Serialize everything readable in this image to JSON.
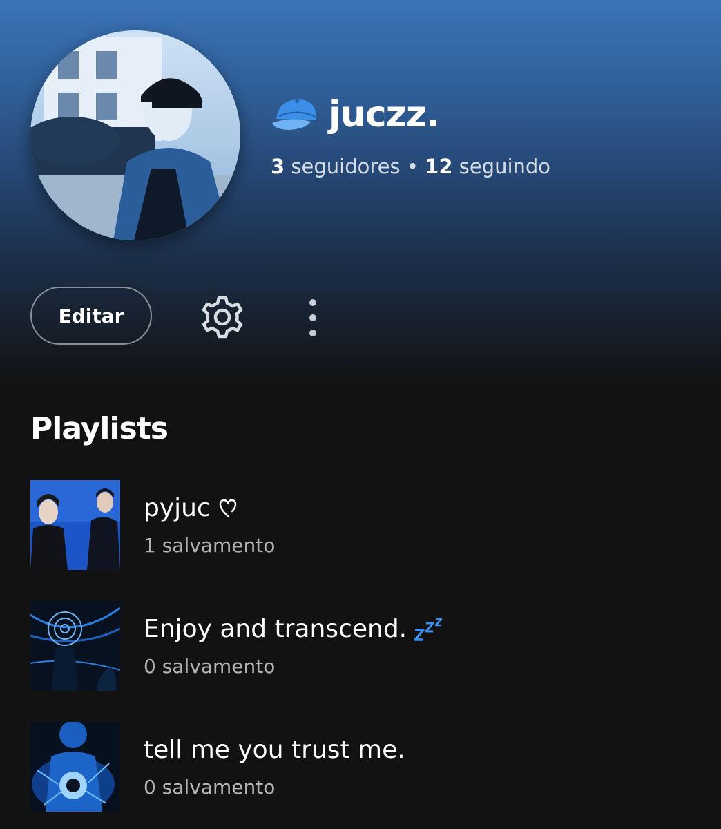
{
  "theme": {
    "accent": "#3b74b8",
    "background": "#121212",
    "secondary_text": "#b3b3b3"
  },
  "profile": {
    "emoji_icon": "blue-cap-icon",
    "username": "juczz.",
    "followers_count": "3",
    "followers_label": "seguidores",
    "separator": "•",
    "following_count": "12",
    "following_label": "seguindo"
  },
  "actions": {
    "edit_label": "Editar",
    "settings_icon": "gear-icon",
    "more_icon": "more-vertical-icon"
  },
  "playlists": {
    "section_title": "Playlists",
    "items": [
      {
        "title": "pyjuc",
        "icon": "heart-outline-icon",
        "saves": "1 salvamento"
      },
      {
        "title": "Enjoy and transcend.",
        "icon": "zzz-icon",
        "saves": "0 salvamento"
      },
      {
        "title": "tell me you trust me.",
        "icon": "",
        "saves": "0 salvamento"
      }
    ]
  }
}
